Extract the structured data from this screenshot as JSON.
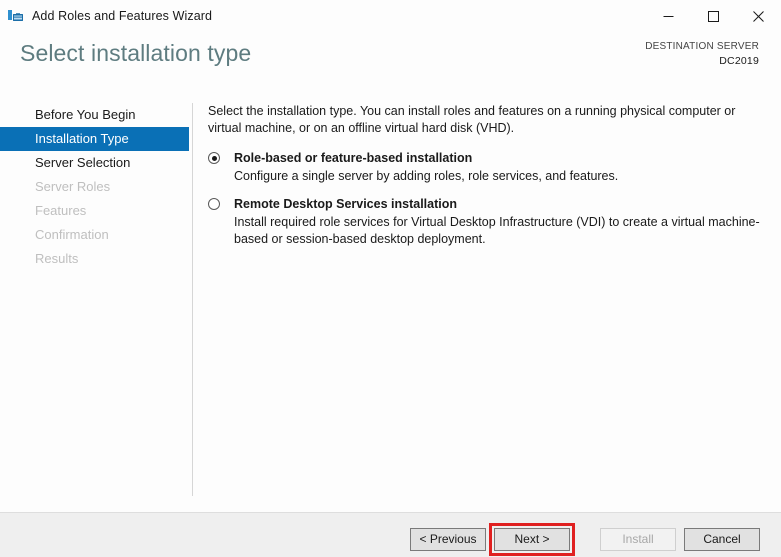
{
  "window": {
    "title": "Add Roles and Features Wizard",
    "app_icon": "server-toolbox-icon",
    "controls": {
      "minimize": "minimize-icon",
      "maximize": "maximize-icon",
      "close": "close-icon"
    }
  },
  "header": {
    "page_title": "Select installation type",
    "destination_label": "DESTINATION SERVER",
    "destination_name": "DC2019"
  },
  "sidebar": {
    "items": [
      {
        "label": "Before You Begin",
        "state": "enabled"
      },
      {
        "label": "Installation Type",
        "state": "selected"
      },
      {
        "label": "Server Selection",
        "state": "enabled"
      },
      {
        "label": "Server Roles",
        "state": "disabled"
      },
      {
        "label": "Features",
        "state": "disabled"
      },
      {
        "label": "Confirmation",
        "state": "disabled"
      },
      {
        "label": "Results",
        "state": "disabled"
      }
    ]
  },
  "content": {
    "intro": "Select the installation type. You can install roles and features on a running physical computer or virtual machine, or on an offline virtual hard disk (VHD).",
    "options": [
      {
        "label": "Role-based or feature-based installation",
        "description": "Configure a single server by adding roles, role services, and features.",
        "selected": true
      },
      {
        "label": "Remote Desktop Services installation",
        "description": "Install required role services for Virtual Desktop Infrastructure (VDI) to create a virtual machine-based or session-based desktop deployment.",
        "selected": false
      }
    ]
  },
  "footer": {
    "previous_label": "< Previous",
    "next_label": "Next >",
    "install_label": "Install",
    "cancel_label": "Cancel"
  },
  "colors": {
    "accent_blue": "#0a70b6",
    "title_teal": "#5e7c80",
    "highlight_red": "#e02020",
    "footer_bg": "#efefef"
  }
}
